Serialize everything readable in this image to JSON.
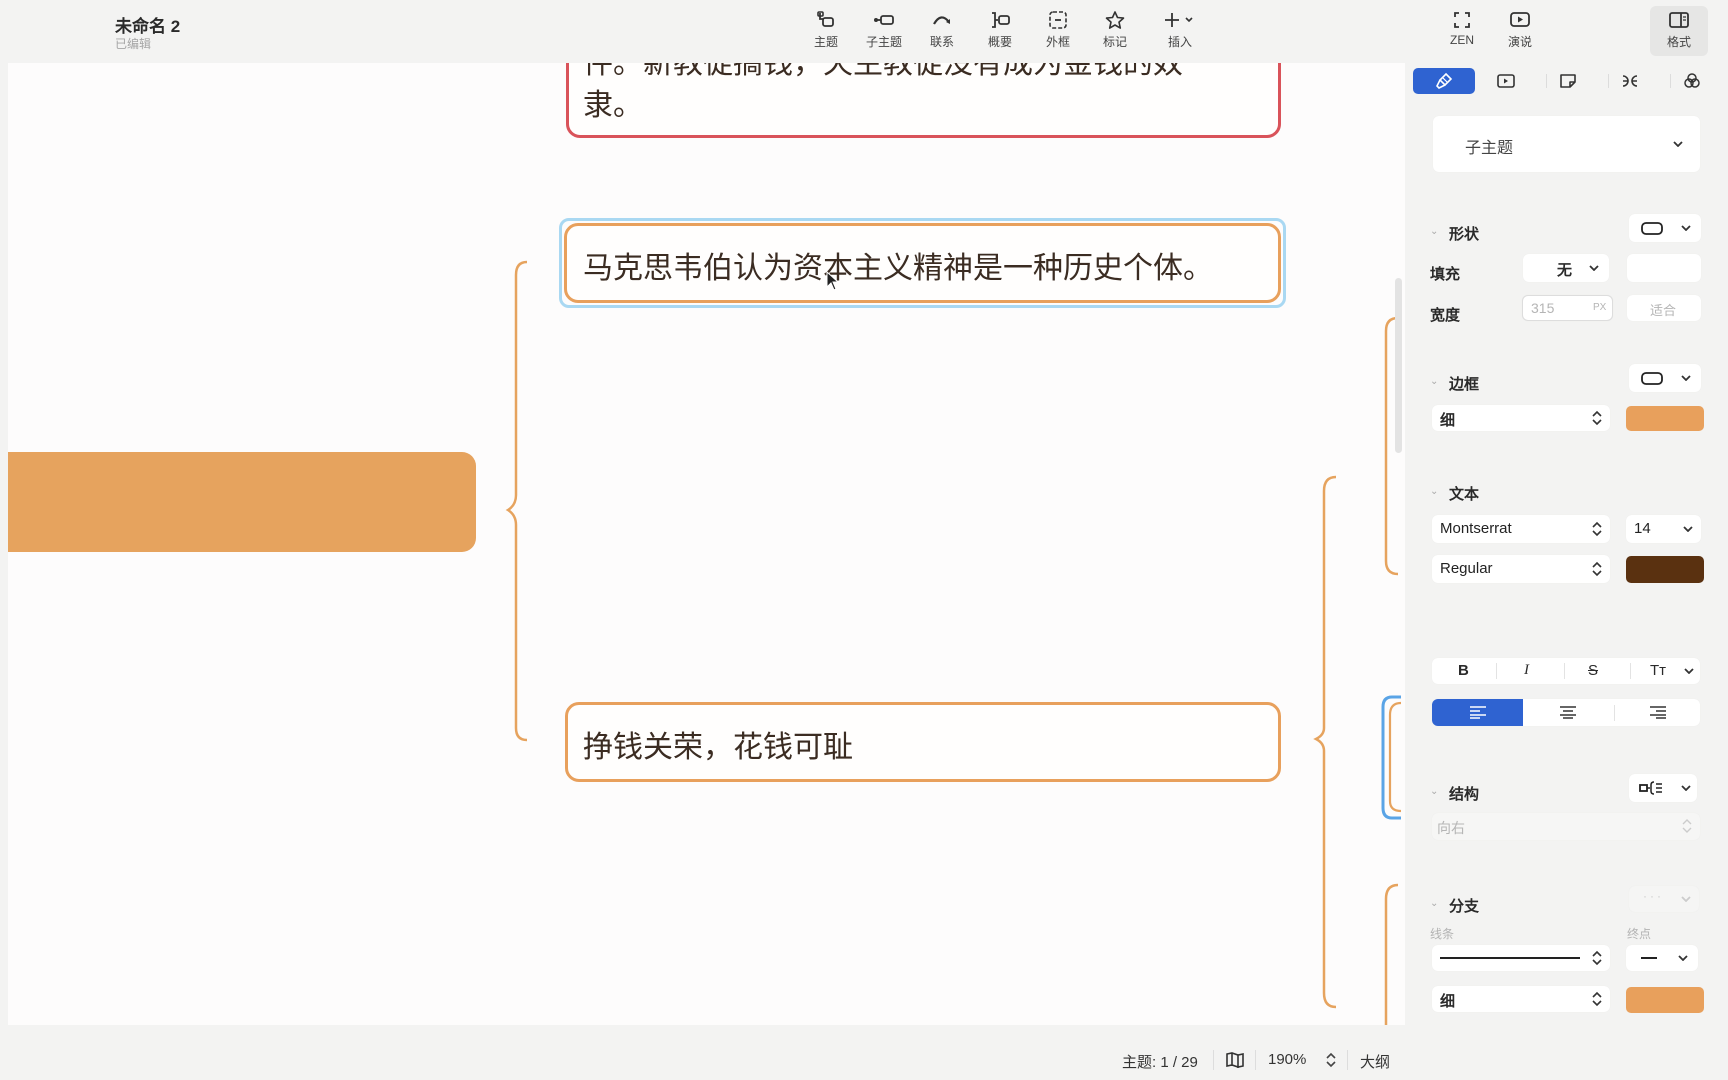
{
  "header": {
    "title": "未命名 2",
    "status": "已编辑",
    "tools": [
      {
        "name": "topic",
        "label": "主题",
        "icon": "topic-icon"
      },
      {
        "name": "subtopic",
        "label": "子主题",
        "icon": "subtopic-icon"
      },
      {
        "name": "relationship",
        "label": "联系",
        "icon": "relationship-icon"
      },
      {
        "name": "summary",
        "label": "概要",
        "icon": "summary-icon"
      },
      {
        "name": "boundary",
        "label": "外框",
        "icon": "boundary-icon"
      },
      {
        "name": "marker",
        "label": "标记",
        "icon": "star-icon"
      },
      {
        "name": "insert",
        "label": "插入",
        "icon": "plus-icon"
      }
    ],
    "right_tools": [
      {
        "name": "zen",
        "label": "ZEN",
        "icon": "zen-icon"
      },
      {
        "name": "pitch",
        "label": "演说",
        "icon": "play-icon"
      },
      {
        "name": "format",
        "label": "格式",
        "icon": "format-panel-icon"
      }
    ]
  },
  "canvas": {
    "nodes": [
      {
        "id": "node-top",
        "line1": "件。新教徒搞钱，天主教徒没有成为金钱的奴",
        "line2": "隶。",
        "border_color": "#d9535a"
      },
      {
        "id": "node-selected",
        "text": "马克思韦伯认为资本主义精神是一种历史个体。",
        "border_color": "#e8a05c",
        "selection_color": "#9fd3f0"
      },
      {
        "id": "node-bottom",
        "text": "挣钱关荣，花钱可耻",
        "border_color": "#e8a05c"
      }
    ],
    "parent_node_color": "#e6a35e",
    "branch_color": "#e6a35e"
  },
  "statusbar": {
    "topic_count": "主题: 1 / 29",
    "zoom": "190%",
    "outline": "大纲"
  },
  "panel": {
    "tabs": [
      {
        "name": "style",
        "icon": "brush-icon",
        "active": true
      },
      {
        "name": "pitch",
        "icon": "play-icon",
        "active": false
      },
      {
        "name": "note",
        "icon": "sticky-note-icon",
        "active": false
      },
      {
        "name": "map-structure",
        "icon": "structure-icon",
        "active": false
      },
      {
        "name": "theme",
        "icon": "color-circles-icon",
        "active": false
      }
    ],
    "topic_type": "子主题",
    "shape": {
      "title": "形状",
      "fill_label": "填充",
      "fill_value": "无",
      "width_label": "宽度",
      "width_value": "315",
      "width_unit": "PX",
      "fit_label": "适合"
    },
    "border": {
      "title": "边框",
      "weight": "细",
      "color": "#e8a05c"
    },
    "text": {
      "title": "文本",
      "font": "Montserrat",
      "size": "14",
      "weight": "Regular",
      "color": "#5a3110",
      "bold": "B",
      "italic": "I",
      "strike": "S",
      "case": "Tт",
      "align": "left"
    },
    "structure": {
      "title": "结构",
      "direction": "向右"
    },
    "branch": {
      "title": "分支",
      "line_label": "线条",
      "end_label": "终点",
      "weight": "细",
      "color": "#e8a05c"
    },
    "accent_color": "#2f63d1"
  }
}
